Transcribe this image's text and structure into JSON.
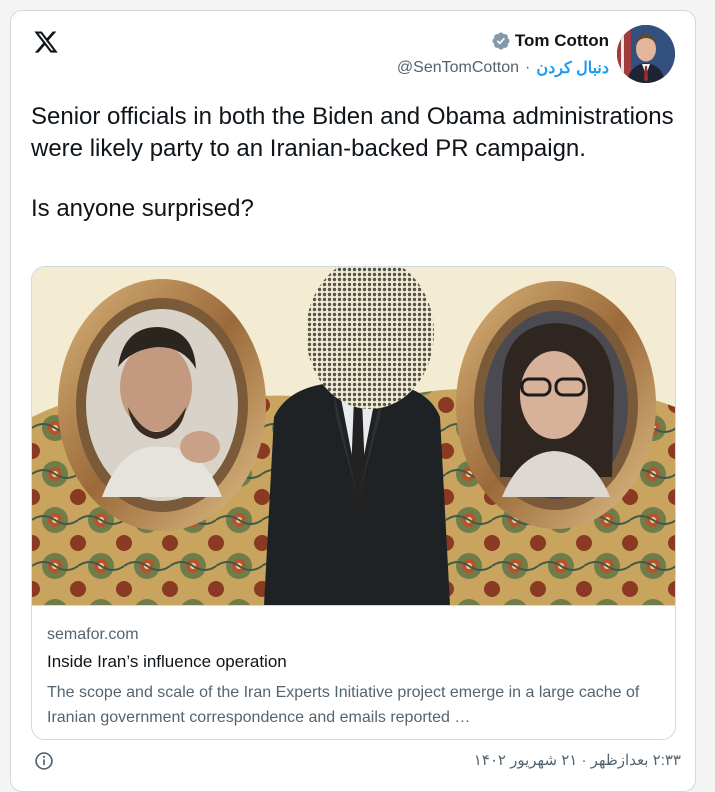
{
  "author": {
    "name": "Tom Cotton",
    "handle": "@SenTomCotton",
    "follow_label": "دنبال کردن",
    "separator": "·"
  },
  "tweet": {
    "paragraphs": [
      "Senior officials in both the Biden and Obama administrations were likely party to an Iranian-backed PR campaign.",
      "Is anyone surprised?"
    ]
  },
  "link_card": {
    "domain": "semafor.com",
    "title": "Inside Iran’s influence operation",
    "description": "The scope and scale of the Iran Experts Initiative project emerge in a large cache of Iranian government correspondence and emails reported …"
  },
  "footer": {
    "timestamp": "۲:۳۳ بعدازظهر · ۲۱ شهریور ۱۴۰۲"
  },
  "icons": {
    "logo": "x-logo-icon",
    "verified": "verified-badge-icon",
    "info": "info-icon"
  },
  "colors": {
    "accent": "#1d9bf0",
    "text": "#0f1419",
    "secondary": "#536471",
    "border": "#cfd9de"
  }
}
